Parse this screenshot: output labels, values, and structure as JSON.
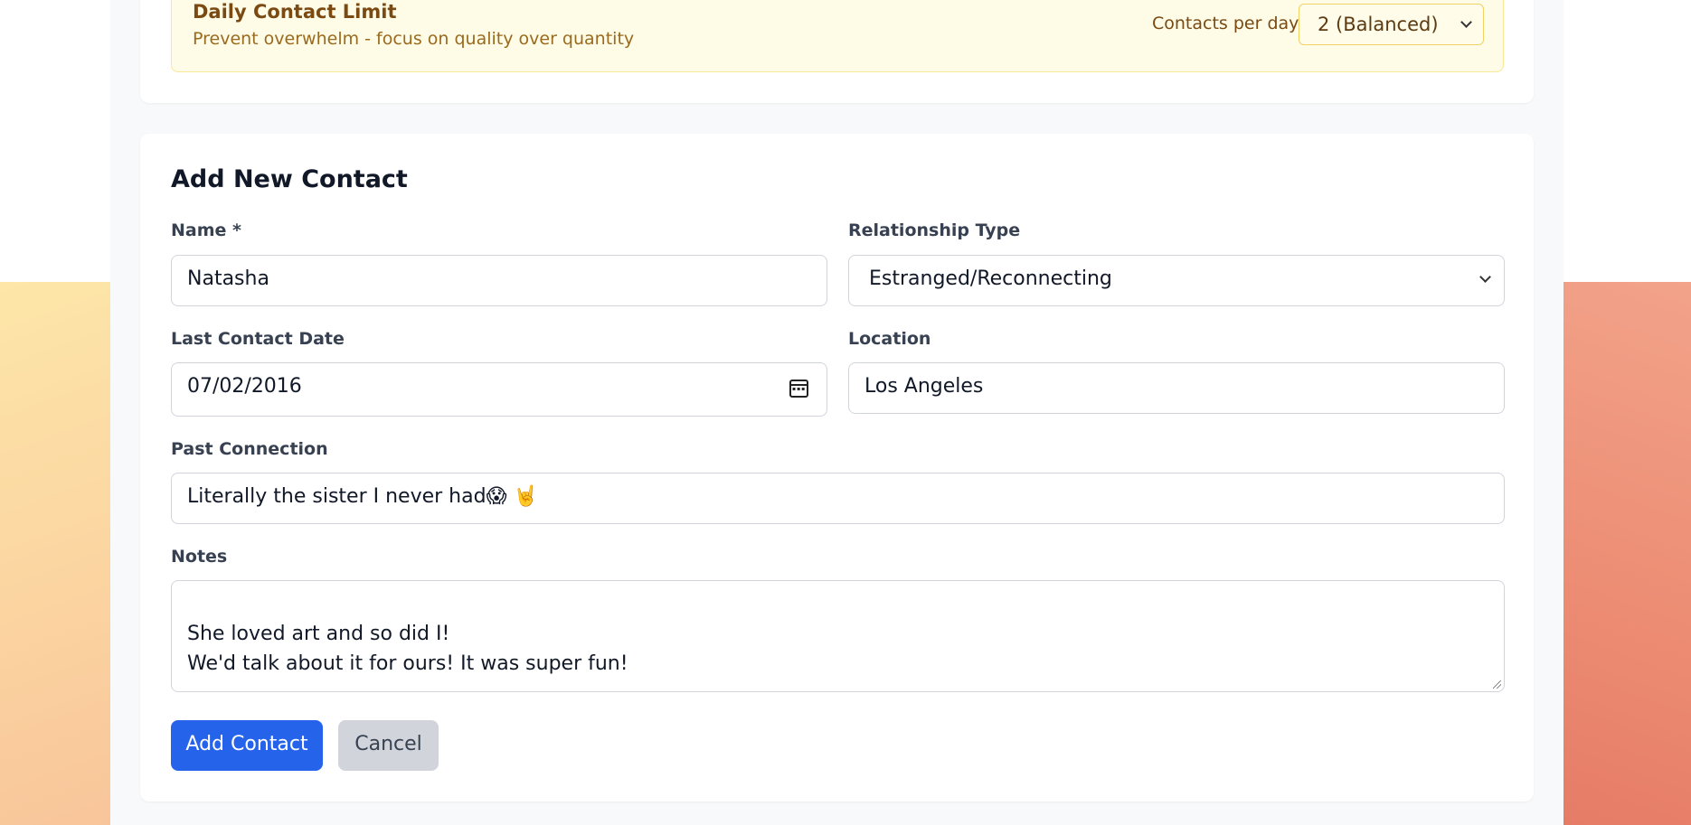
{
  "daily_limit": {
    "title": "Daily Contact Limit",
    "subtitle": "Prevent overwhelm - focus on quality over quantity",
    "per_day_label": "Contacts per day:",
    "per_day_value": "2 (Balanced)"
  },
  "form": {
    "title": "Add New Contact",
    "name": {
      "label": "Name *",
      "value": "Natasha"
    },
    "relationship": {
      "label": "Relationship Type",
      "value": "Estranged/Reconnecting"
    },
    "last_contact": {
      "label": "Last Contact Date",
      "value": "07/02/2016"
    },
    "location": {
      "label": "Location",
      "value": "Los Angeles"
    },
    "past_connection": {
      "label": "Past Connection",
      "value": "Literally the sister I never had😱 🤘"
    },
    "notes": {
      "label": "Notes",
      "value": "She loved art and so did I!\nWe'd talk about it for ours! It was super fun!"
    },
    "submit_label": "Add Contact",
    "cancel_label": "Cancel"
  },
  "colors": {
    "primary": "#2563eb",
    "warning_bg": "#fefbe6",
    "warning_border": "#f9e79a"
  },
  "icons": [
    "calendar-icon",
    "chevron-down-icon",
    "resize-handle-icon"
  ]
}
